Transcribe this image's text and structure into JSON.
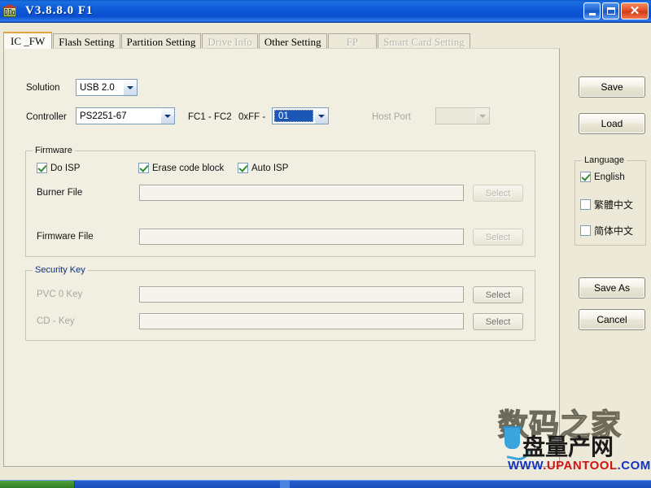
{
  "window": {
    "title": "V3.8.8.0 F1",
    "icon": "app-icon",
    "buttons": {
      "minimize": "minimize-icon",
      "maximize": "maximize-icon",
      "close": "close-icon"
    }
  },
  "tabs": [
    {
      "label": "IC _FW",
      "state": "active"
    },
    {
      "label": "Flash Setting",
      "state": "enabled"
    },
    {
      "label": "Partition Setting",
      "state": "enabled"
    },
    {
      "label": "Drive Info",
      "state": "disabled"
    },
    {
      "label": "Other Setting",
      "state": "enabled"
    },
    {
      "label": "FP",
      "state": "disabled"
    },
    {
      "label": "Smart Card Setting",
      "state": "disabled"
    }
  ],
  "form": {
    "solution": {
      "label": "Solution",
      "value": "USB 2.0"
    },
    "controller": {
      "label": "Controller",
      "value": "PS2251-67"
    },
    "fc_range": {
      "label": "FC1 - FC2",
      "prefix": "0xFF -",
      "value": "01"
    },
    "host_port": {
      "label": "Host Port",
      "value": ""
    }
  },
  "firmware": {
    "legend": "Firmware",
    "checkboxes": [
      {
        "label": "Do ISP",
        "checked": true
      },
      {
        "label": "Erase code block",
        "checked": true
      },
      {
        "label": "Auto ISP",
        "checked": true
      }
    ],
    "fields": [
      {
        "label": "Burner File",
        "value": "",
        "button": "Select"
      },
      {
        "label": "Firmware File",
        "value": "",
        "button": "Select"
      }
    ]
  },
  "security": {
    "legend": "Security Key",
    "fields": [
      {
        "label": "PVC 0 Key",
        "value": "",
        "button": "Select"
      },
      {
        "label": "CD - Key",
        "value": "",
        "button": "Select"
      }
    ]
  },
  "rail": {
    "save": "Save",
    "load": "Load",
    "save_as": "Save As",
    "cancel": "Cancel",
    "language": {
      "legend": "Language",
      "options": [
        {
          "label": "English",
          "checked": true
        },
        {
          "label": "繁體中文",
          "checked": false
        },
        {
          "label": "简体中文",
          "checked": false
        }
      ]
    }
  },
  "watermark": {
    "line1": "数码之家",
    "line2": "盘量产网",
    "url_prefix": "WWW",
    "url_dot1": ".",
    "url_main": "UPANTOOL",
    "url_dot2": ".",
    "url_tld": "COM"
  },
  "colors": {
    "title_bar": "#0b4fd0",
    "active_tab_accent": "#e8a33d",
    "panel_bg": "#f1efe2",
    "legend_blue": "#0c2f8a",
    "check_green": "#2f8c2f",
    "combo_select_blue": "#1d57b5"
  }
}
